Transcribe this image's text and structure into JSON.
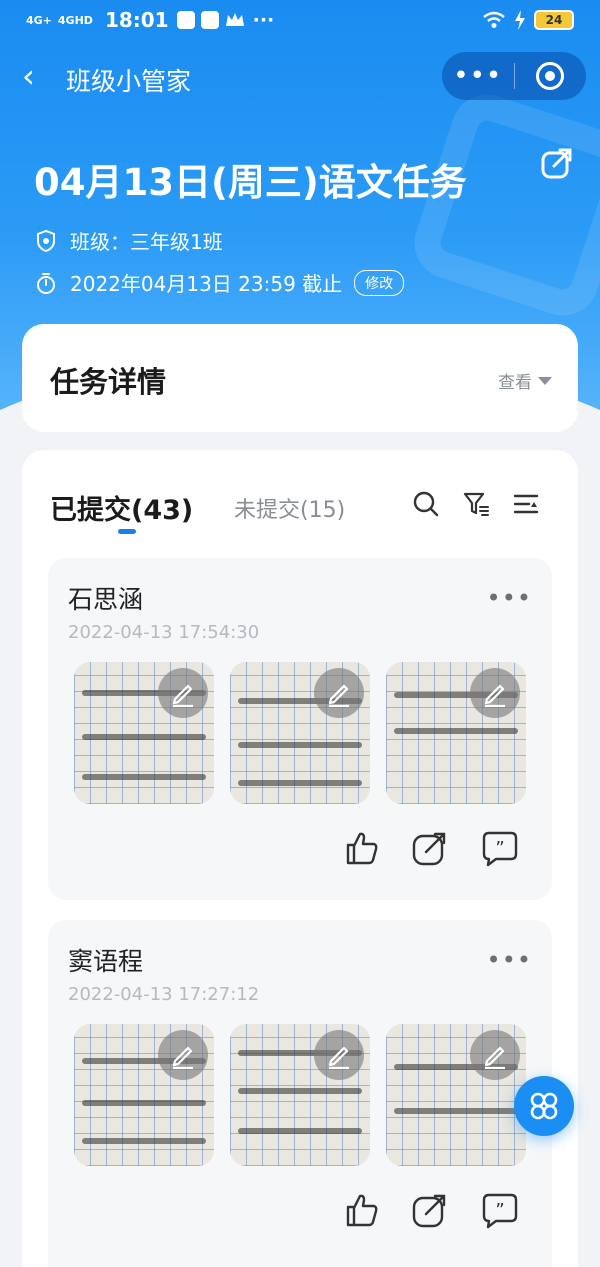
{
  "status_bar": {
    "signal_1": "4G+",
    "signal_2": "4GHD",
    "time": "18:01",
    "more": "···",
    "battery": "24"
  },
  "nav": {
    "back": "‹",
    "title": "班级小管家",
    "more": "•••"
  },
  "task": {
    "title": "04月13日(周三)语文任务",
    "class_label": "班级：三年级1班",
    "deadline": "2022年04月13日 23:59 截止",
    "edit_tag": "修改"
  },
  "detail": {
    "heading": "任务详情",
    "view": "查看"
  },
  "tabs": {
    "submitted": "已提交(43)",
    "not_submitted": "未提交(15)"
  },
  "submissions": [
    {
      "name": "石思涵",
      "time": "2022-04-13 17:54:30",
      "photos": 3
    },
    {
      "name": "窦语程",
      "time": "2022-04-13 17:27:12",
      "photos": 3
    }
  ],
  "icons": {
    "search": "search-icon",
    "filter": "filter-icon",
    "sort": "sort-icon",
    "like": "thumbs-up-icon",
    "share": "share-icon",
    "comment": "comment-icon",
    "edit": "pencil-icon",
    "menu": "grid-menu-icon"
  },
  "colors": {
    "primary": "#1a8cf1",
    "accent": "#1a7fe8",
    "background": "#f1f3f6"
  }
}
